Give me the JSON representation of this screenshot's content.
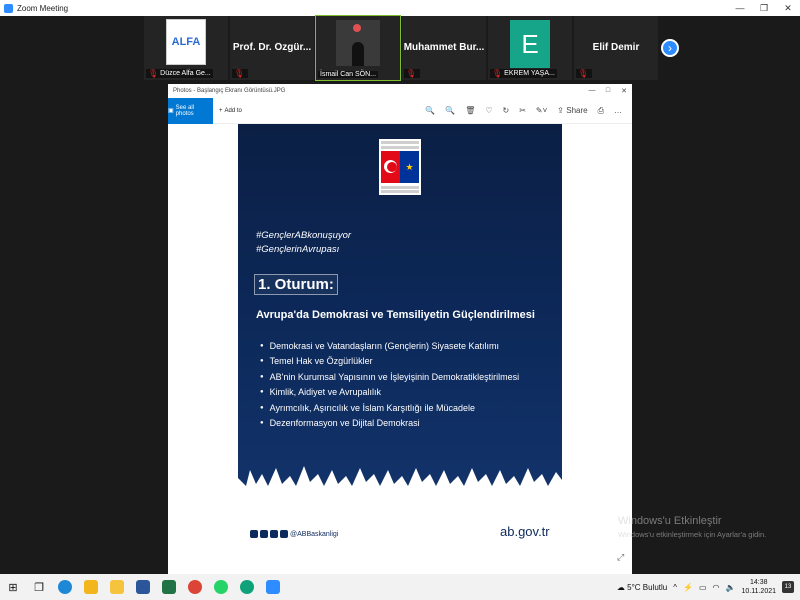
{
  "window": {
    "title": "Zoom Meeting",
    "controls": [
      "—",
      "❐",
      "✕"
    ]
  },
  "participants": [
    {
      "display_name": "",
      "label": "Düzce Alfa Ge...",
      "logo_text": "ALFA",
      "muted": true
    },
    {
      "display_name": "Prof. Dr. Özgür...",
      "label": "",
      "muted": true
    },
    {
      "display_name": "",
      "label": "İsmail Can SÖN...",
      "muted": false,
      "active": true
    },
    {
      "display_name": "Muhammet Bur...",
      "label": "",
      "muted": true
    },
    {
      "display_name": "",
      "label": "EKREM YAŞA...",
      "avatar_letter": "E",
      "muted": true
    },
    {
      "display_name": "Elif Demir",
      "label": "",
      "muted": true
    }
  ],
  "gallery_next_icon": "›",
  "photos": {
    "title": "Photos - Başlangıç Ekranı Görüntüsü.JPG",
    "see_all": "See all photos",
    "add_to": "Add to",
    "share": "Share",
    "window_controls": [
      "—",
      "□",
      "✕"
    ],
    "tool_icons": [
      "🔍",
      "🔍",
      "🗑",
      "♡",
      "↻",
      "✂"
    ]
  },
  "slide": {
    "hashtags": [
      "#GençlerABkonuşuyor",
      "#GençlerinAvrupası"
    ],
    "session": "1. Oturum:",
    "heading": "Avrupa'da Demokrasi ve Temsiliyetin Güçlendirilmesi",
    "topics": [
      "Demokrasi ve Vatandaşların (Gençlerin) Siyasete Katılımı",
      "Temel Hak ve Özgürlükler",
      "AB'nin Kurumsal Yapısının ve İşleyişinin Demokratikleştirilmesi",
      "Kimlik, Aidiyet ve Avrupalılık",
      "Ayrımcılık, Aşırıcılık ve İslam Karşıtlığı ile Mücadele",
      "Dezenformasyon ve Dijital Demokrasi"
    ],
    "social_handle": "@ABBaskanligi",
    "website": "ab.gov.tr"
  },
  "watermark": {
    "title": "Windows'u Etkinleştir",
    "subtitle": "Windows'u etkinleştirmek için Ayarlar'a gidin."
  },
  "taskbar": {
    "weather": "5°C  Bulutlu",
    "time": "14:38",
    "date": "10.11.2021",
    "notifications": "13"
  },
  "colors": {
    "accent": "#2d8cff",
    "slide_bg": "#0d2a5c",
    "photos_accent": "#0078d4",
    "muted_red": "#e02828"
  }
}
